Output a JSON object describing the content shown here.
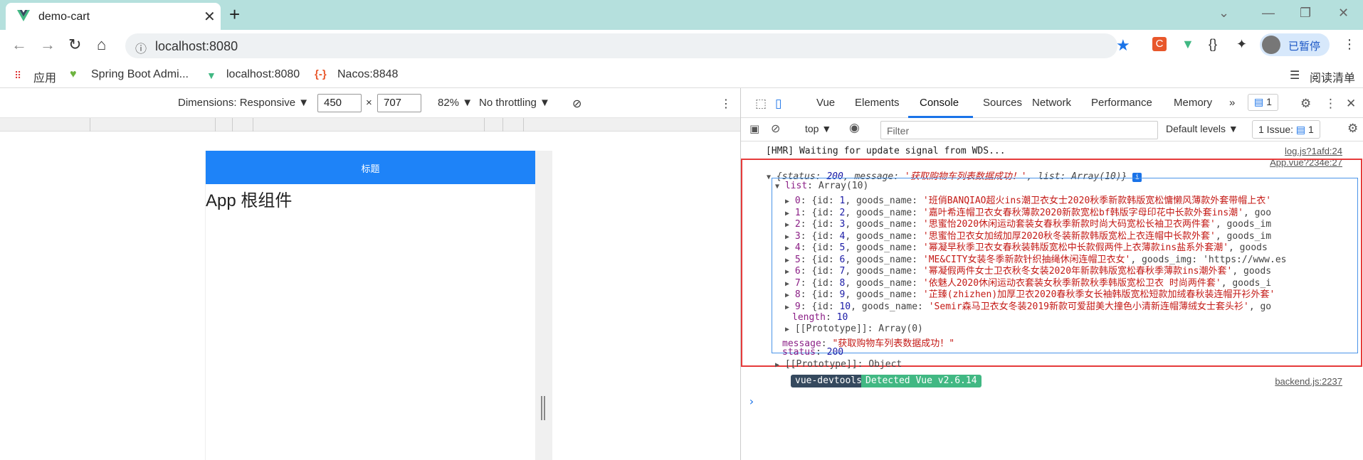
{
  "browser": {
    "tab_title": "demo-cart",
    "tab_close": "✕",
    "new_tab": "+",
    "url": "localhost:8080",
    "profile_status": "已暂停"
  },
  "bookmarks": [
    {
      "label": "应用",
      "icon": "apps-grid-icon"
    },
    {
      "label": "Spring Boot Admi...",
      "icon": "spring-boot-icon"
    },
    {
      "label": "localhost:8080",
      "icon": "vue-logo-icon"
    },
    {
      "label": "Nacos:8848",
      "icon": "nacos-icon"
    }
  ],
  "reading_list": "阅读清单",
  "emulation": {
    "dimensions": "Dimensions: Responsive ▼",
    "width": "450",
    "times": "×",
    "height": "707",
    "zoom": "82% ▼",
    "throttling": "No throttling ▼"
  },
  "page": {
    "header_title": "标题",
    "root_text": "App 根组件"
  },
  "devtools": {
    "tabs": [
      "Vue",
      "Elements",
      "Console",
      "Sources",
      "Network",
      "Performance",
      "Memory"
    ],
    "active_tab": "Console",
    "more": "»",
    "badge_count": "1",
    "context": "top ▼",
    "filter_placeholder": "Filter",
    "levels": "Default levels ▼",
    "issues": "1 Issue:",
    "issues_count": "1"
  },
  "console": {
    "hmr_line": "[HMR] Waiting for update signal from WDS...",
    "hmr_source": "log.js?1afd:24",
    "app_source": "App.vue?234e:27",
    "obj_summary_pre": "{status: ",
    "obj_summary_status": "200",
    "obj_summary_mid": ", message: ",
    "obj_summary_message": "'获取购物车列表数据成功！'",
    "obj_summary_post": ", list: Array(10)}",
    "list_key": "list",
    "list_type": ": Array(10)",
    "items": [
      {
        "index": "0",
        "id": "1",
        "name": "'班俏BANQIAO超火ins潮卫衣女士2020秋季新款韩版宽松慵懒风薄款外套带帽上衣'",
        "tail": ""
      },
      {
        "index": "1",
        "id": "2",
        "name": "'嘉叶希连帽卫衣女春秋薄款2020新款宽松bf韩版字母印花中长款外套ins潮'",
        "tail": ", goo"
      },
      {
        "index": "2",
        "id": "3",
        "name": "'思蜜怡2020休闲运动套装女春秋季新款时尚大码宽松长袖卫衣两件套'",
        "tail": ", goods_im"
      },
      {
        "index": "3",
        "id": "4",
        "name": "'思蜜怡卫衣女加绒加厚2020秋冬装新款韩版宽松上衣连帽中长款外套'",
        "tail": ", goods_im"
      },
      {
        "index": "4",
        "id": "5",
        "name": "'幂凝早秋季卫衣女春秋装韩版宽松中长款假两件上衣薄款ins盐系外套潮'",
        "tail": ", goods"
      },
      {
        "index": "5",
        "id": "6",
        "name": "'ME&CITY女装冬季新款针织抽绳休闲连帽卫衣女'",
        "tail": ", goods_img: 'https://www.es"
      },
      {
        "index": "6",
        "id": "7",
        "name": "'幂凝假两件女士卫衣秋冬女装2020年新款韩版宽松春秋季薄款ins潮外套'",
        "tail": ", goods"
      },
      {
        "index": "7",
        "id": "8",
        "name": "'依魅人2020休闲运动衣套装女秋季新款秋季韩版宽松卫衣 时尚两件套'",
        "tail": ", goods_i"
      },
      {
        "index": "8",
        "id": "9",
        "name": "'芷臻(zhizhen)加厚卫衣2020春秋季女长袖韩版宽松短款加绒春秋装连帽开衫外套'",
        "tail": ""
      },
      {
        "index": "9",
        "id": "10",
        "name": "'Semir森马卫衣女冬装2019新款可爱甜美大撞色小清新连帽薄绒女士套头衫'",
        "tail": ", go"
      }
    ],
    "length_key": "length",
    "length_val": "10",
    "proto_array": "[[Prototype]]",
    "proto_array_val": ": Array(0)",
    "message_key": "message",
    "message_val": "\"获取购物车列表数据成功！\"",
    "status_key": "status",
    "status_val": "200",
    "proto_obj": "[[Prototype]]",
    "proto_obj_val": ": Object",
    "devtools_badge": "vue-devtools",
    "detected_badge": "Detected Vue v2.6.14",
    "backend_source": "backend.js:2237",
    "prompt": "›"
  }
}
